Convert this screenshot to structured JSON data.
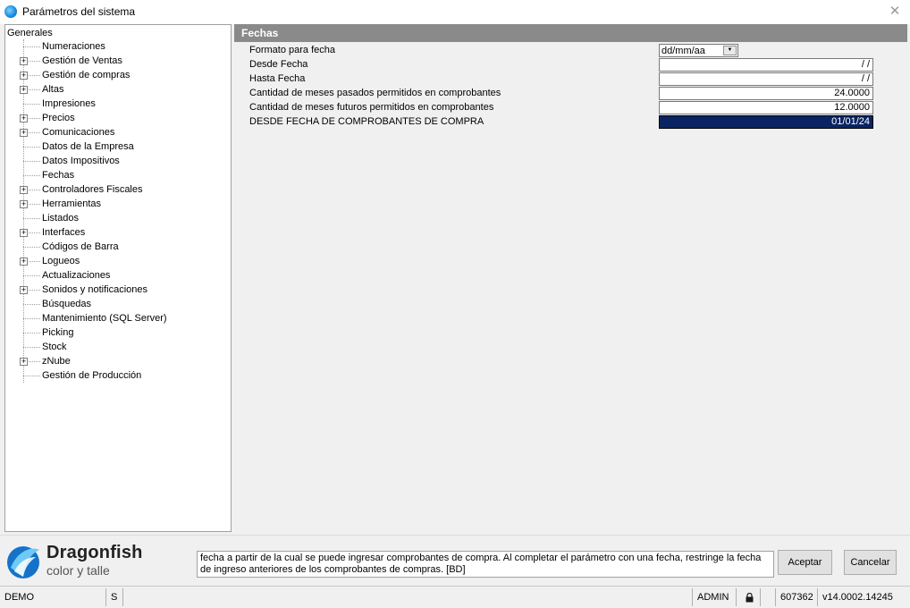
{
  "window": {
    "title": "Parámetros del sistema"
  },
  "tree": {
    "root": "Generales",
    "items": [
      {
        "label": "Numeraciones",
        "expandable": false
      },
      {
        "label": "Gestión de Ventas",
        "expandable": true
      },
      {
        "label": "Gestión de compras",
        "expandable": true
      },
      {
        "label": "Altas",
        "expandable": true
      },
      {
        "label": "Impresiones",
        "expandable": false
      },
      {
        "label": "Precios",
        "expandable": true
      },
      {
        "label": "Comunicaciones",
        "expandable": true
      },
      {
        "label": "Datos de la Empresa",
        "expandable": false
      },
      {
        "label": "Datos Impositivos",
        "expandable": false
      },
      {
        "label": "Fechas",
        "expandable": false,
        "selected": true
      },
      {
        "label": "Controladores Fiscales",
        "expandable": true
      },
      {
        "label": "Herramientas",
        "expandable": true
      },
      {
        "label": "Listados",
        "expandable": false
      },
      {
        "label": "Interfaces",
        "expandable": true
      },
      {
        "label": "Códigos de Barra",
        "expandable": false
      },
      {
        "label": "Logueos",
        "expandable": true
      },
      {
        "label": "Actualizaciones",
        "expandable": false
      },
      {
        "label": "Sonidos y notificaciones",
        "expandable": true
      },
      {
        "label": "Búsquedas",
        "expandable": false
      },
      {
        "label": "Mantenimiento (SQL Server)",
        "expandable": false
      },
      {
        "label": "Picking",
        "expandable": false
      },
      {
        "label": "Stock",
        "expandable": false
      },
      {
        "label": "zNube",
        "expandable": true
      },
      {
        "label": "Gestión de Producción",
        "expandable": false
      }
    ]
  },
  "section": {
    "title": "Fechas",
    "params": [
      {
        "label": "Formato para fecha",
        "value": "dd/mm/aa",
        "type": "combo"
      },
      {
        "label": "Desde Fecha",
        "value": " /  /",
        "type": "date"
      },
      {
        "label": "Hasta Fecha",
        "value": " /  /",
        "type": "date"
      },
      {
        "label": "Cantidad de meses pasados permitidos en comprobantes",
        "value": "24.0000",
        "type": "number"
      },
      {
        "label": "Cantidad de meses futuros permitidos en comprobantes",
        "value": "12.0000",
        "type": "number"
      },
      {
        "label": "DESDE FECHA DE COMPROBANTES DE COMPRA",
        "value": "01/01/24",
        "type": "date",
        "selected": true
      }
    ]
  },
  "footer": {
    "brand_name": "Dragonfish",
    "brand_sub": "color y talle",
    "help_text": "fecha a partir de la cual se puede ingresar comprobantes de compra. Al completar el parámetro con una fecha, restringe la fecha de ingreso anteriores de los comprobantes de compras. [BD]",
    "accept_label": "Aceptar",
    "cancel_label": "Cancelar"
  },
  "statusbar": {
    "base": "DEMO",
    "mode": "S",
    "user": "ADMIN",
    "serial": "607362",
    "version": "v14.0002.14245"
  },
  "colors": {
    "accent": "#0a2463",
    "header": "#8a8a8a"
  }
}
